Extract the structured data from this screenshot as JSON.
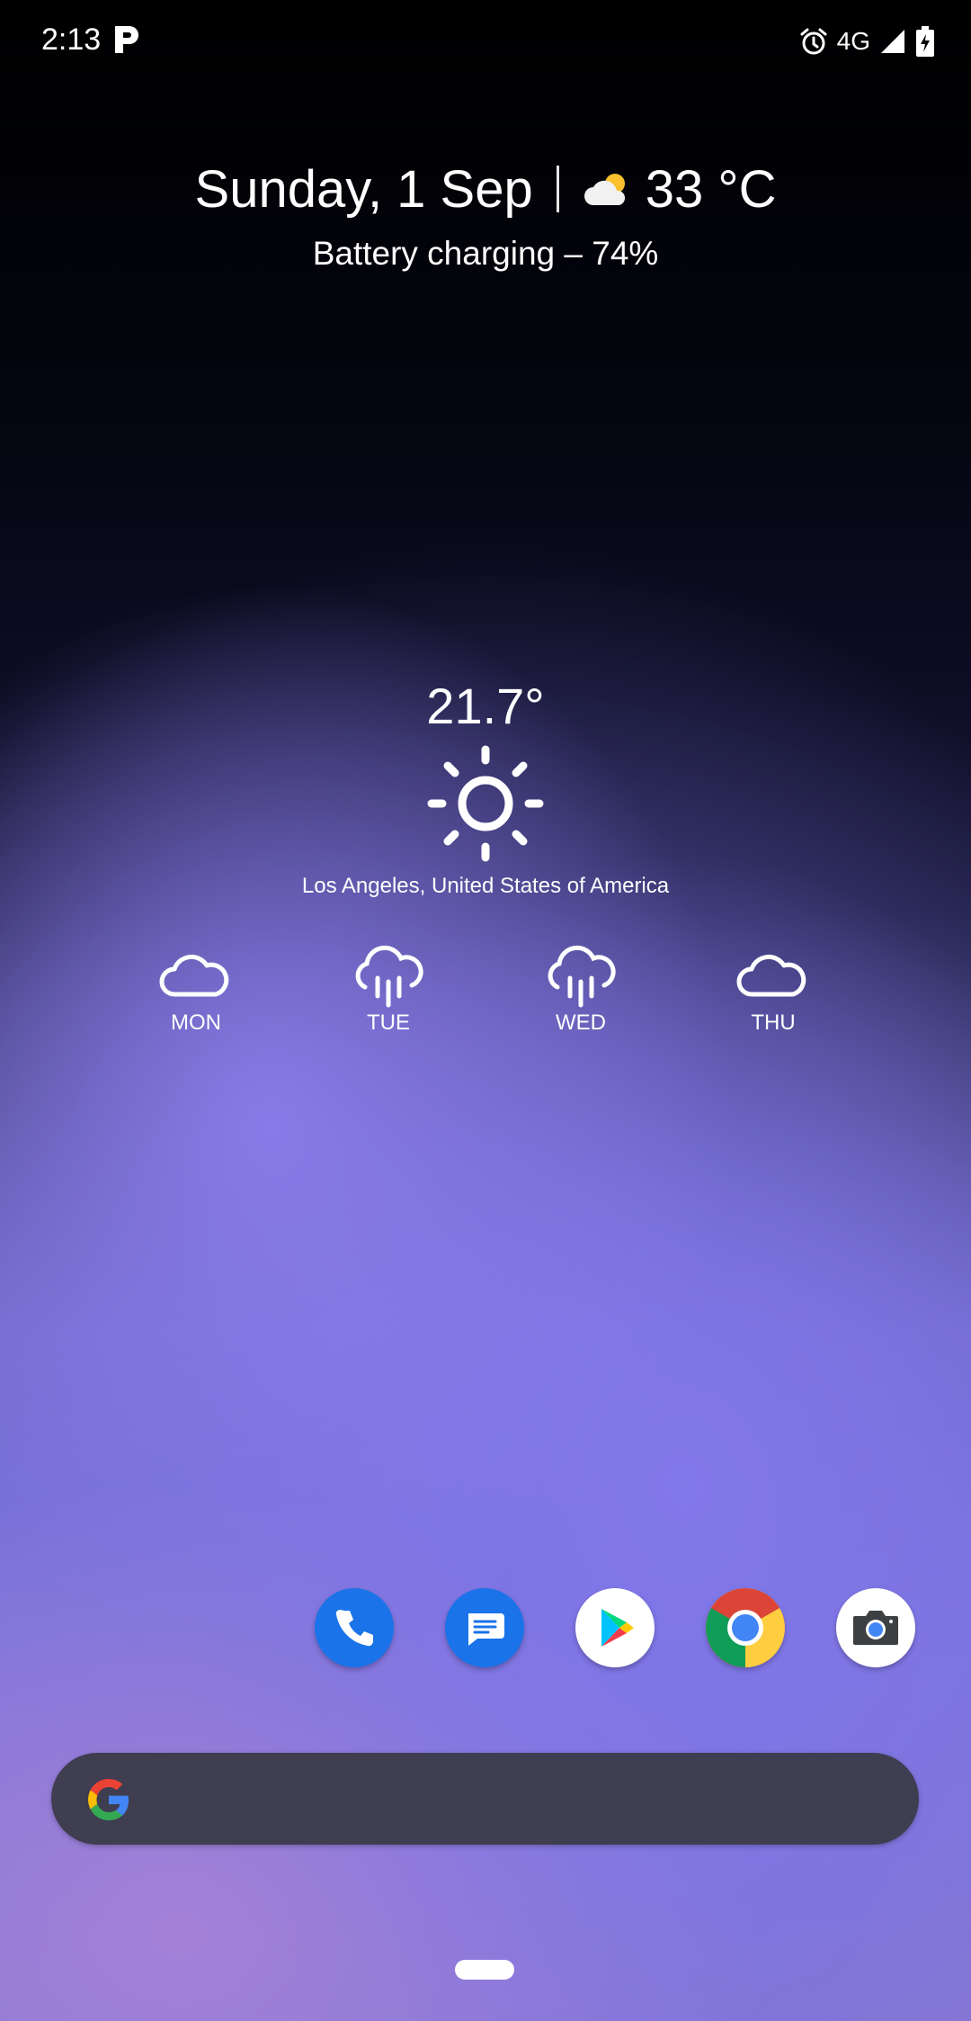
{
  "status_bar": {
    "time": "2:13",
    "network": "4G",
    "icons": [
      "parking-p-icon",
      "alarm-icon",
      "signal-icon",
      "battery-charging-icon"
    ]
  },
  "glance": {
    "date": "Sunday, 1 Sep",
    "temperature": "33 °C",
    "weather_icon": "partly-sunny-cloud-icon",
    "battery_status": "Battery charging – 74%"
  },
  "weather_widget": {
    "current_temp": "21.7°",
    "condition_icon": "sun-icon",
    "location": "Los Angeles,  United States of America",
    "forecast": [
      {
        "day": "MON",
        "icon": "cloud-icon"
      },
      {
        "day": "TUE",
        "icon": "rain-cloud-icon"
      },
      {
        "day": "WED",
        "icon": "rain-cloud-icon"
      },
      {
        "day": "THU",
        "icon": "cloud-icon"
      }
    ]
  },
  "dock": {
    "apps": [
      {
        "name": "Phone",
        "icon": "phone-icon",
        "color": "#1a73e8"
      },
      {
        "name": "Messages",
        "icon": "messages-icon",
        "color": "#1a73e8"
      },
      {
        "name": "Play Store",
        "icon": "play-store-icon",
        "color": "#ffffff"
      },
      {
        "name": "Chrome",
        "icon": "chrome-icon",
        "color": "#ffffff"
      },
      {
        "name": "Camera",
        "icon": "camera-icon",
        "color": "#ffffff"
      }
    ]
  },
  "search": {
    "icon": "google-g-icon"
  }
}
